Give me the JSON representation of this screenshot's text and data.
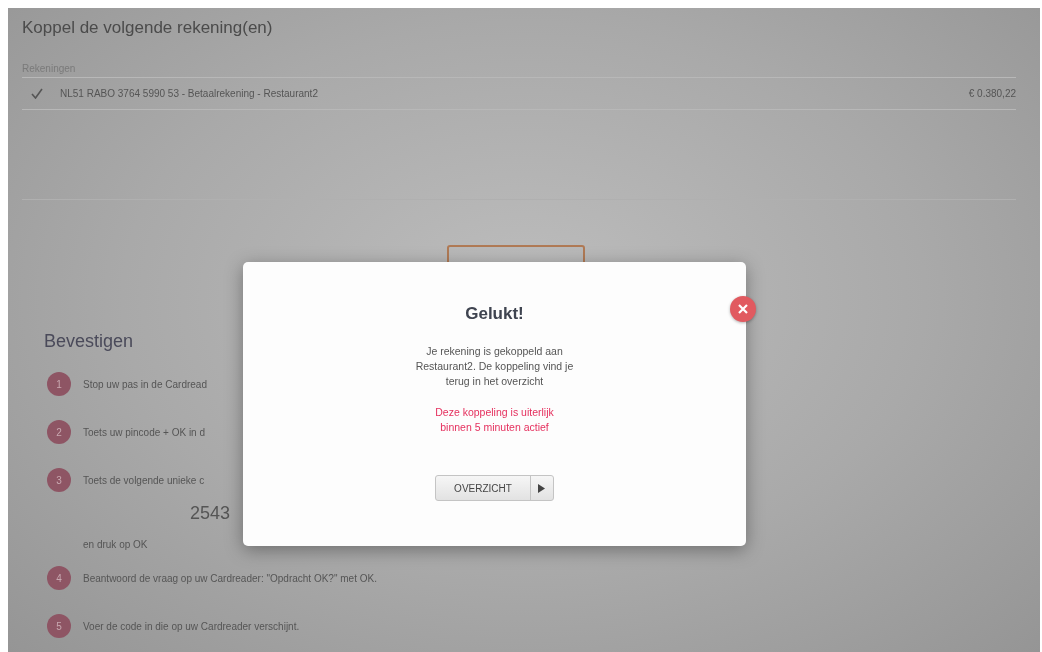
{
  "page": {
    "title": "Koppel de volgende rekening(en)",
    "accounts_header": "Rekeningen",
    "accounts": [
      {
        "checked": true,
        "account": "NL51 RABO 3764 5990 53 - Betaalrekening - Restaurant2",
        "balance": "€ 0.380,22"
      }
    ]
  },
  "confirm": {
    "title": "Bevestigen",
    "steps": [
      {
        "kind": "step",
        "number": "1",
        "text": "Stop uw pas in de Cardread"
      },
      {
        "kind": "step",
        "number": "2",
        "text": "Toets uw pincode + OK in d"
      },
      {
        "kind": "step",
        "number": "3",
        "text": "Toets de volgende unieke c"
      },
      {
        "kind": "code",
        "text": "2543"
      },
      {
        "kind": "note",
        "text": "en druk op OK"
      },
      {
        "kind": "step",
        "number": "4",
        "text": "Beantwoord de vraag op uw Cardreader: \"Opdracht OK?\" met OK."
      },
      {
        "kind": "step",
        "number": "5",
        "text": "Voer de code in die op uw Cardreader verschijnt."
      }
    ]
  },
  "dialog": {
    "title": "Gelukt!",
    "message": "Je rekening is gekoppeld aan Restaurant2. De koppeling vind je terug in het overzicht",
    "warning": "Deze koppeling is uiterlijk binnen 5 minuten actief",
    "button": "OVERZICHT"
  }
}
